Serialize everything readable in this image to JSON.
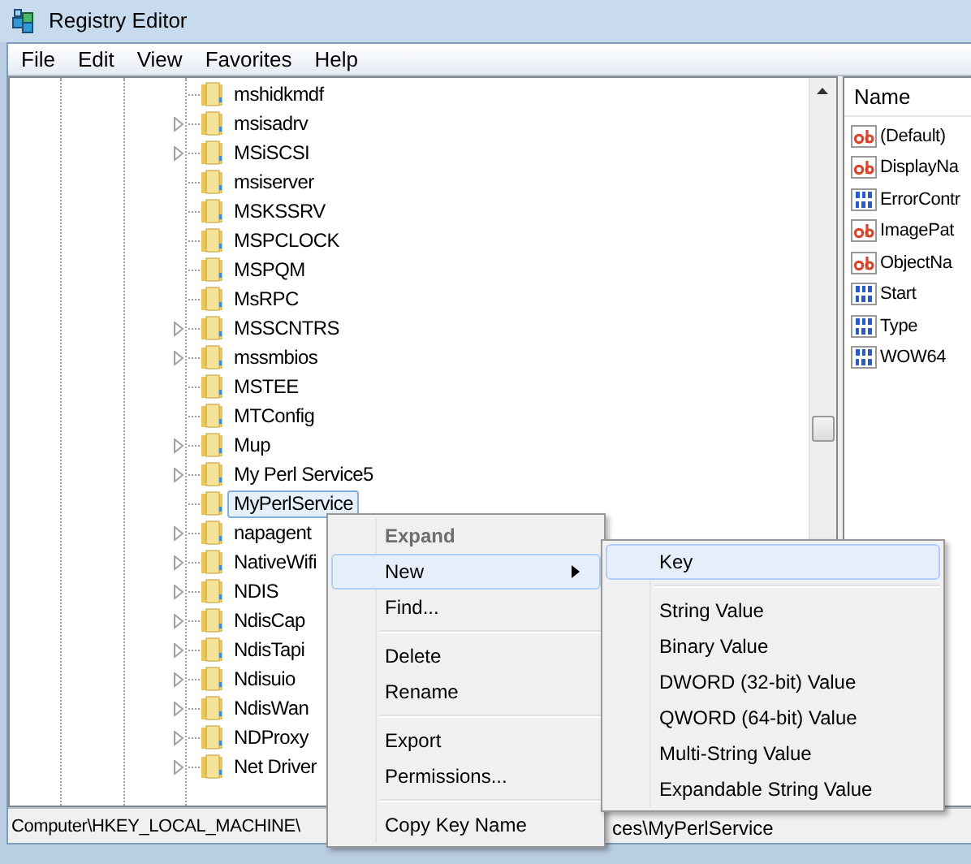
{
  "window": {
    "title": "Registry Editor"
  },
  "menu_bar": [
    "File",
    "Edit",
    "View",
    "Favorites",
    "Help"
  ],
  "tree": {
    "items": [
      {
        "label": "mshidkmdf",
        "expandable": false,
        "selected": false
      },
      {
        "label": "msisadrv",
        "expandable": true,
        "selected": false
      },
      {
        "label": "MSiSCSI",
        "expandable": true,
        "selected": false
      },
      {
        "label": "msiserver",
        "expandable": false,
        "selected": false
      },
      {
        "label": "MSKSSRV",
        "expandable": false,
        "selected": false
      },
      {
        "label": "MSPCLOCK",
        "expandable": false,
        "selected": false
      },
      {
        "label": "MSPQM",
        "expandable": false,
        "selected": false
      },
      {
        "label": "MsRPC",
        "expandable": false,
        "selected": false
      },
      {
        "label": "MSSCNTRS",
        "expandable": true,
        "selected": false
      },
      {
        "label": "mssmbios",
        "expandable": true,
        "selected": false
      },
      {
        "label": "MSTEE",
        "expandable": false,
        "selected": false
      },
      {
        "label": "MTConfig",
        "expandable": false,
        "selected": false
      },
      {
        "label": "Mup",
        "expandable": true,
        "selected": false
      },
      {
        "label": "My Perl Service5",
        "expandable": true,
        "selected": false
      },
      {
        "label": "MyPerlService",
        "expandable": false,
        "selected": true
      },
      {
        "label": "napagent",
        "expandable": true,
        "selected": false
      },
      {
        "label": "NativeWifi",
        "expandable": true,
        "selected": false
      },
      {
        "label": "NDIS",
        "expandable": true,
        "selected": false
      },
      {
        "label": "NdisCap",
        "expandable": true,
        "selected": false
      },
      {
        "label": "NdisTapi",
        "expandable": true,
        "selected": false
      },
      {
        "label": "Ndisuio",
        "expandable": true,
        "selected": false
      },
      {
        "label": "NdisWan",
        "expandable": true,
        "selected": false
      },
      {
        "label": "NDProxy",
        "expandable": true,
        "selected": false
      },
      {
        "label": "Net Driver",
        "expandable": true,
        "selected": false
      }
    ]
  },
  "values": {
    "column_header": "Name",
    "items": [
      {
        "name": "(Default)",
        "kind": "string"
      },
      {
        "name": "DisplayNa",
        "kind": "string"
      },
      {
        "name": "ErrorContr",
        "kind": "binary"
      },
      {
        "name": "ImagePat",
        "kind": "string"
      },
      {
        "name": "ObjectNa",
        "kind": "string"
      },
      {
        "name": "Start",
        "kind": "binary"
      },
      {
        "name": "Type",
        "kind": "binary"
      },
      {
        "name": "WOW64",
        "kind": "binary"
      }
    ]
  },
  "status_bar": {
    "left": "Computer\\HKEY_LOCAL_MACHINE\\",
    "right": "ces\\MyPerlService"
  },
  "context_menu": {
    "items": [
      {
        "kind": "item",
        "label": "Expand",
        "default": true,
        "disabled": true,
        "selected": false,
        "submenu": false
      },
      {
        "kind": "item",
        "label": "New",
        "default": false,
        "disabled": false,
        "selected": true,
        "submenu": true
      },
      {
        "kind": "item",
        "label": "Find...",
        "default": false,
        "disabled": false,
        "selected": false,
        "submenu": false
      },
      {
        "kind": "separator"
      },
      {
        "kind": "item",
        "label": "Delete",
        "default": false,
        "disabled": false,
        "selected": false,
        "submenu": false
      },
      {
        "kind": "item",
        "label": "Rename",
        "default": false,
        "disabled": false,
        "selected": false,
        "submenu": false
      },
      {
        "kind": "separator"
      },
      {
        "kind": "item",
        "label": "Export",
        "default": false,
        "disabled": false,
        "selected": false,
        "submenu": false
      },
      {
        "kind": "item",
        "label": "Permissions...",
        "default": false,
        "disabled": false,
        "selected": false,
        "submenu": false
      },
      {
        "kind": "separator"
      },
      {
        "kind": "item",
        "label": "Copy Key Name",
        "default": false,
        "disabled": false,
        "selected": false,
        "submenu": false
      }
    ]
  },
  "submenu": {
    "items": [
      {
        "kind": "item",
        "label": "Key",
        "default": false,
        "disabled": false,
        "selected": true,
        "submenu": false
      },
      {
        "kind": "separator"
      },
      {
        "kind": "item",
        "label": "String Value",
        "default": false,
        "disabled": false,
        "selected": false,
        "submenu": false
      },
      {
        "kind": "item",
        "label": "Binary Value",
        "default": false,
        "disabled": false,
        "selected": false,
        "submenu": false
      },
      {
        "kind": "item",
        "label": "DWORD (32-bit) Value",
        "default": false,
        "disabled": false,
        "selected": false,
        "submenu": false
      },
      {
        "kind": "item",
        "label": "QWORD (64-bit) Value",
        "default": false,
        "disabled": false,
        "selected": false,
        "submenu": false
      },
      {
        "kind": "item",
        "label": "Multi-String Value",
        "default": false,
        "disabled": false,
        "selected": false,
        "submenu": false
      },
      {
        "kind": "item",
        "label": "Expandable String Value",
        "default": false,
        "disabled": false,
        "selected": false,
        "submenu": false
      }
    ]
  }
}
